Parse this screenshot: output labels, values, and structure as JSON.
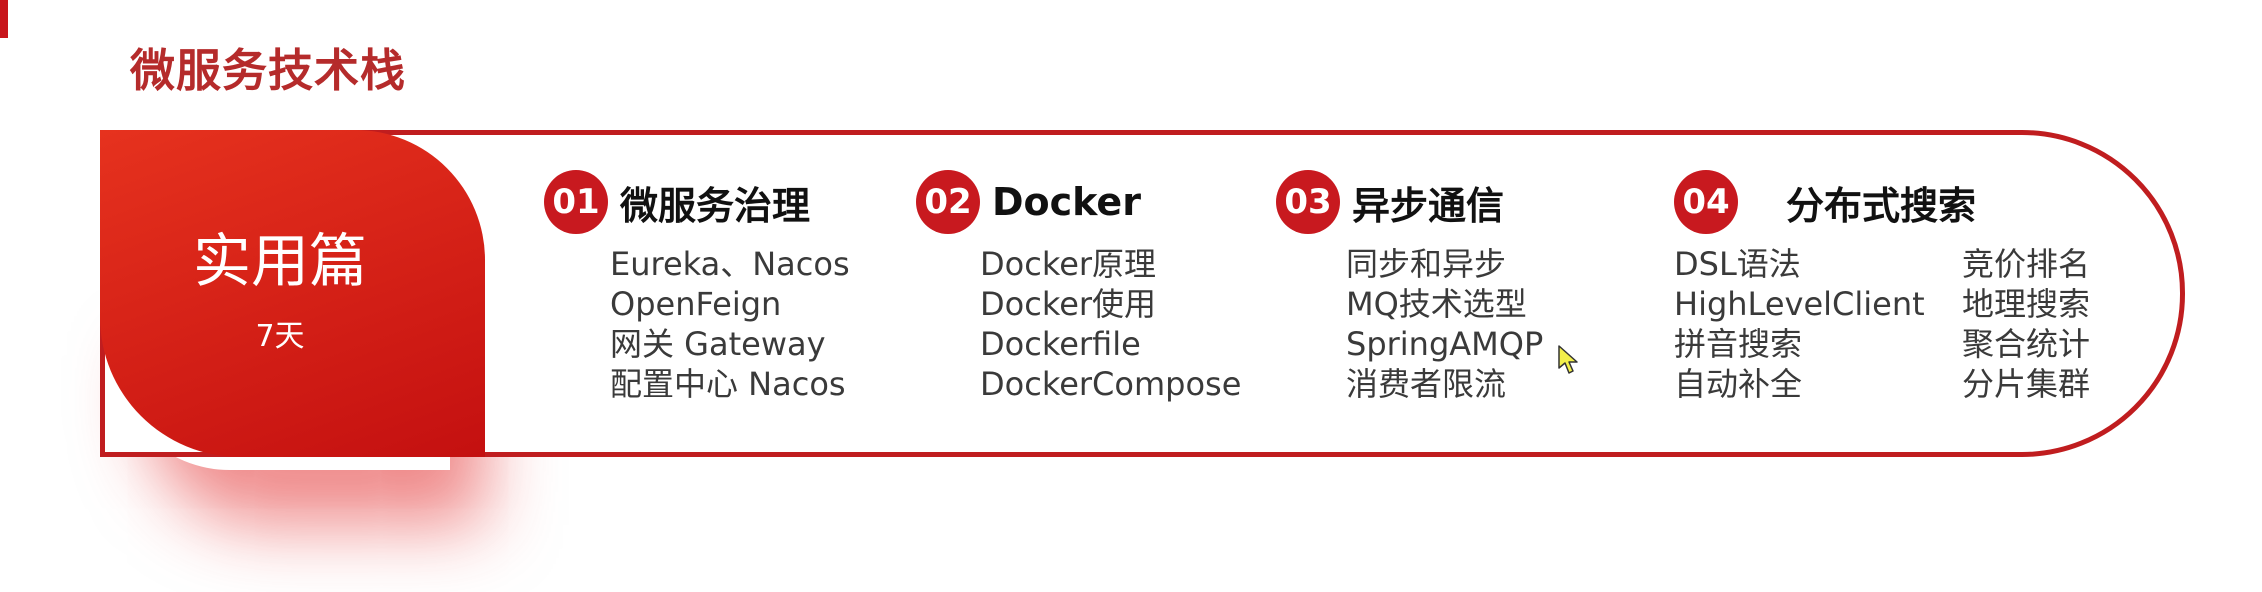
{
  "page": {
    "title": "微服务技术栈"
  },
  "banner": {
    "accent": {
      "title": "实用篇",
      "subtitle": "7天",
      "color": "#c8191f"
    },
    "sections": [
      {
        "number": "01",
        "title": "微服务治理",
        "items": [
          "Eureka、Nacos",
          "OpenFeign",
          "网关 Gateway",
          "配置中心 Nacos"
        ]
      },
      {
        "number": "02",
        "title": "Docker",
        "items": [
          "Docker原理",
          "Docker使用",
          "Dockerfile",
          "DockerCompose"
        ]
      },
      {
        "number": "03",
        "title": "异步通信",
        "items": [
          "同步和异步",
          "MQ技术选型",
          "SpringAMQP",
          "消费者限流"
        ]
      },
      {
        "number": "04",
        "title": "分布式搜索",
        "items": [
          "DSL语法",
          "HighLevelClient",
          "拼音搜索",
          "自动补全"
        ],
        "items_col2": [
          "竞价排名",
          "地理搜索",
          "聚合统计",
          "分片集群"
        ]
      }
    ]
  },
  "icons": {
    "cursor": "mouse-pointer-icon"
  }
}
